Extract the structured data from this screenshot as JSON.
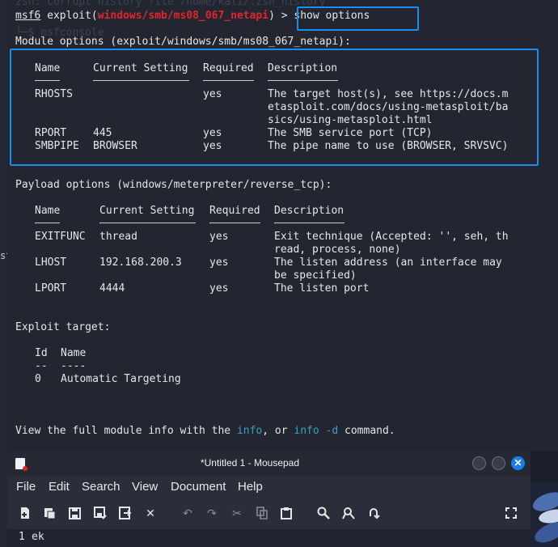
{
  "desktop": {
    "left_text": "st"
  },
  "terminal": {
    "ghost_line_1": "zsh: corrupt history file /home/kali/.zsh_history",
    "ghost_line_2": "└─$ msfconsole",
    "prompt": {
      "prefix": "msf6",
      "exploit_word": "exploit(",
      "module": "windows/smb/ms08_067_netapi",
      "close": ")",
      "arrow": ">",
      "command": "show options"
    },
    "module_options": {
      "heading": "Module options (exploit/windows/smb/ms08_067_netapi):",
      "headers": [
        "Name",
        "Current Setting",
        "Required",
        "Description"
      ],
      "rows": [
        {
          "name": "RHOSTS",
          "setting": "",
          "required": "yes",
          "description": [
            "The target host(s), see https://docs.m",
            "etasploit.com/docs/using-metasploit/ba",
            "sics/using-metasploit.html"
          ]
        },
        {
          "name": "RPORT",
          "setting": "445",
          "required": "yes",
          "description": [
            "The SMB service port (TCP)"
          ]
        },
        {
          "name": "SMBPIPE",
          "setting": "BROWSER",
          "required": "yes",
          "description": [
            "The pipe name to use (BROWSER, SRVSVC)"
          ]
        }
      ]
    },
    "payload_options": {
      "heading": "Payload options (windows/meterpreter/reverse_tcp):",
      "headers": [
        "Name",
        "Current Setting",
        "Required",
        "Description"
      ],
      "rows": [
        {
          "name": "EXITFUNC",
          "setting": "thread",
          "required": "yes",
          "description": [
            "Exit technique (Accepted: '', seh, th",
            "read, process, none)"
          ]
        },
        {
          "name": "LHOST",
          "setting": "192.168.200.3",
          "required": "yes",
          "description": [
            "The listen address (an interface may",
            "be specified)"
          ]
        },
        {
          "name": "LPORT",
          "setting": "4444",
          "required": "yes",
          "description": [
            "The listen port"
          ]
        }
      ]
    },
    "exploit_target": {
      "heading": "Exploit target:",
      "headers": [
        "Id",
        "Name"
      ],
      "dashes": [
        "--",
        "----"
      ],
      "rows": [
        {
          "id": "0",
          "name": "Automatic Targeting"
        }
      ]
    },
    "footer": {
      "part1": "View the full module info with the ",
      "info": "info",
      "part2": ", or ",
      "info_d": "info -d",
      "part3": " command."
    }
  },
  "mousepad": {
    "title": "*Untitled 1 - Mousepad",
    "menu": [
      "File",
      "Edit",
      "Search",
      "View",
      "Document",
      "Help"
    ],
    "toolbar_icons": [
      "new-document-icon",
      "new-window-icon",
      "save-icon",
      "save-as-icon",
      "reload-icon",
      "close-icon",
      "undo-icon",
      "redo-icon",
      "cut-icon",
      "copy-icon",
      "paste-icon",
      "find-icon",
      "find-replace-icon",
      "go-to-icon",
      "fullscreen-icon"
    ],
    "editor": {
      "line_number": "1",
      "text": "ek"
    },
    "colors": {
      "close_button": "#1a7ee8",
      "highlight_box": "#1a8ee8",
      "module_red": "#e0262c",
      "command_cyan": "#3b9fc0"
    }
  }
}
